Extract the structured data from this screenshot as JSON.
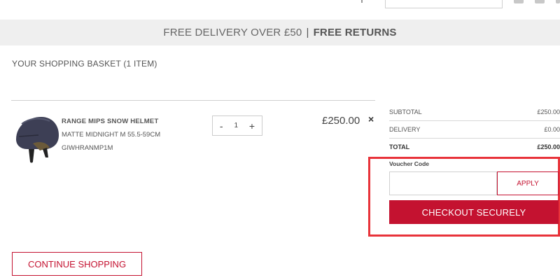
{
  "promo": {
    "delivery_text": "FREE DELIVERY OVER £50",
    "separator": "|",
    "returns_text": "FREE RETURNS"
  },
  "basket": {
    "title": "YOUR SHOPPING BASKET (1 ITEM)"
  },
  "item": {
    "name": "RANGE MIPS SNOW HELMET",
    "variant": "MATTE MIDNIGHT M 55.5-59CM",
    "sku": "GIWHRANMP1M",
    "qty_minus": "-",
    "qty_value": "1",
    "qty_plus": "+",
    "price": "£250.00",
    "remove_symbol": "×"
  },
  "summary": {
    "subtotal_label": "SUBTOTAL",
    "subtotal_value": "£250.00",
    "delivery_label": "DELIVERY",
    "delivery_value": "£0.00",
    "total_label": "TOTAL",
    "total_value": "£250.00"
  },
  "voucher": {
    "label": "Voucher Code",
    "value": "",
    "apply_label": "APPLY"
  },
  "checkout_label": "CHECKOUT SECURELY",
  "continue_label": "CONTINUE SHOPPING",
  "colors": {
    "brand_red": "#c41230",
    "highlight_red": "#e8333a",
    "promo_bg": "#efefef"
  },
  "icons": {
    "product_image": "helmet-image",
    "remove": "close-icon"
  }
}
